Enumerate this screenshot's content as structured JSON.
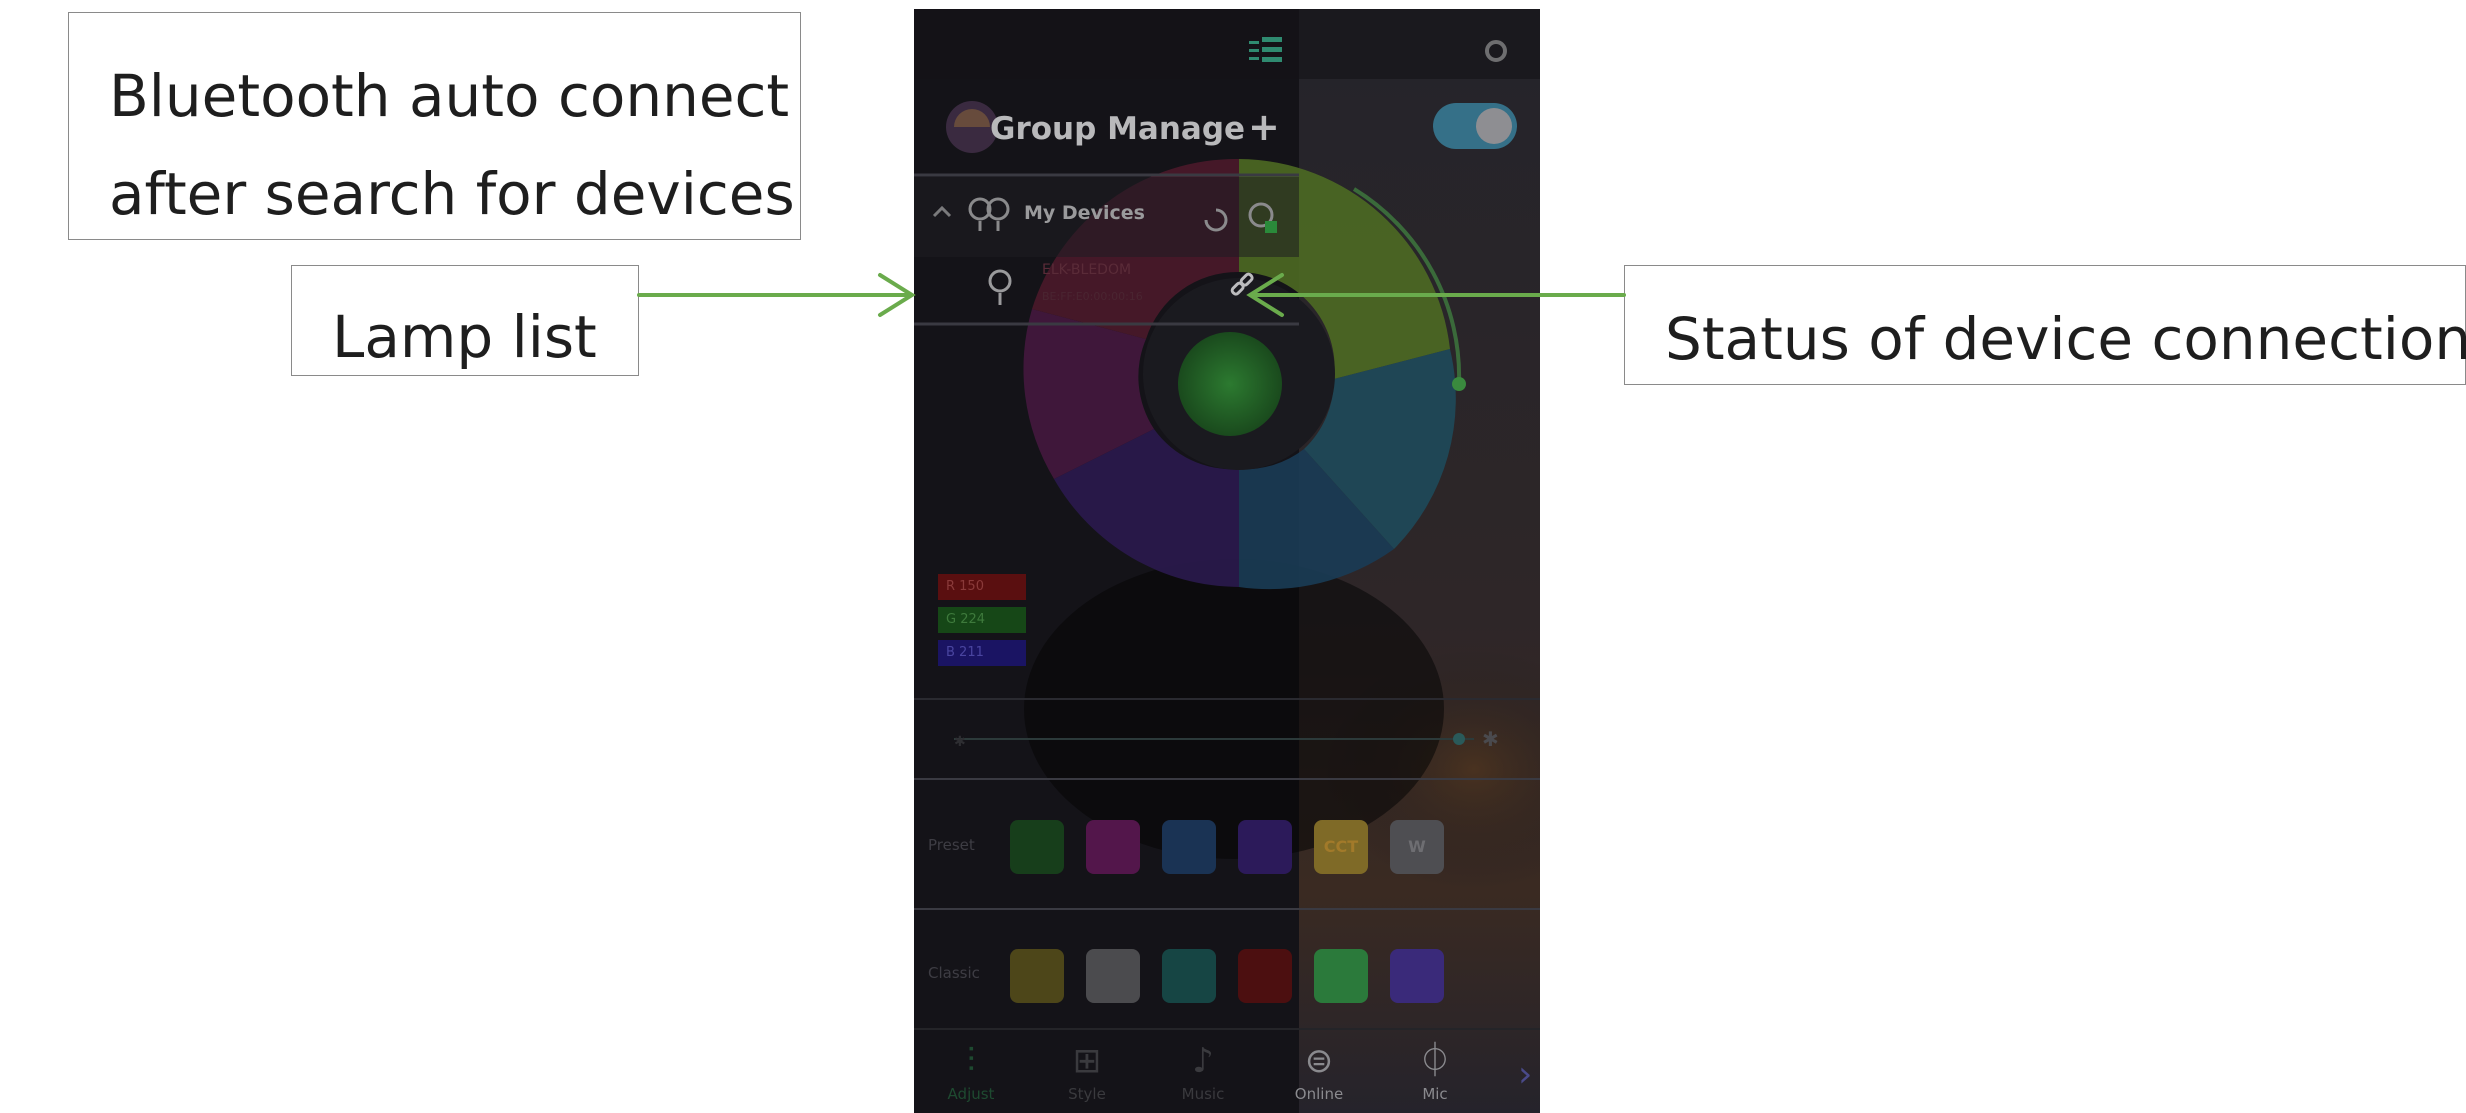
{
  "annotations": {
    "top_clipped_text": "... ... ... ... ... ... ... ... ... ... ... ... ... ... ...",
    "auto_connect": {
      "line1": "Bluetooth auto connect",
      "line2": "after search for devices"
    },
    "lamp_list": "Lamp list",
    "status_connection": "Status of device connection",
    "arrow_color": "#6aab4c"
  },
  "app": {
    "group_title": "Group Manage",
    "group_add": "+",
    "power_toggle": "on",
    "device_group": "My Devices",
    "device": {
      "name": "ELK-BLEDOM",
      "mac": "BE:FF:E0:00:00:16"
    },
    "rgb": {
      "r": "R 150",
      "g": "G 224",
      "b": "B 211"
    },
    "preset_label": "Preset",
    "classic_label": "Classic",
    "preset_swatches": [
      {
        "color": "#173e1b",
        "text": ""
      },
      {
        "color": "#53164b",
        "text": ""
      },
      {
        "color": "#1a3354",
        "text": ""
      },
      {
        "color": "#2c1a5a",
        "text": ""
      },
      {
        "color": "#7f6a27",
        "text": "CCT"
      },
      {
        "color": "#4e4e52",
        "text": "W"
      }
    ],
    "classic_swatches": [
      {
        "color": "#4d4619"
      },
      {
        "color": "#4b4b4e"
      },
      {
        "color": "#164544"
      },
      {
        "color": "#4c0f10"
      },
      {
        "color": "#2b7a3b"
      },
      {
        "color": "#3a2a7a"
      }
    ],
    "nav": [
      {
        "icon": "adjust-icon",
        "glyph": "⫶",
        "label": "Adjust"
      },
      {
        "icon": "style-icon",
        "glyph": "⊞",
        "label": "Style"
      },
      {
        "icon": "music-icon",
        "glyph": "♪",
        "label": "Music"
      },
      {
        "icon": "online-icon",
        "glyph": "⊜",
        "label": "Online"
      },
      {
        "icon": "mic-icon",
        "glyph": "⏀",
        "label": "Mic"
      }
    ],
    "nav_more": "›"
  }
}
